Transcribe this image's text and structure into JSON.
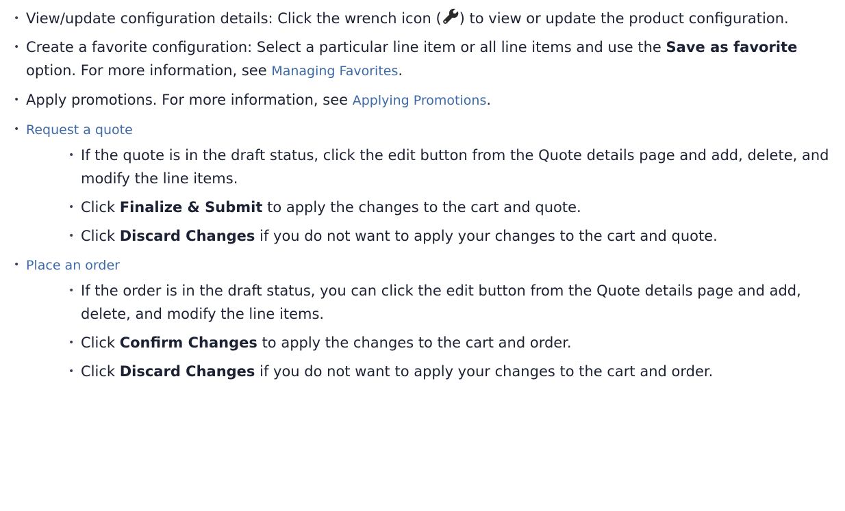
{
  "items": [
    {
      "text1": "View/update configuration details: Click the wrench icon (",
      "icon": "wrench-icon",
      "text2": ") to view or update the product configuration."
    },
    {
      "text1": "Create a favorite configuration: Select a particular line item or all line items and use the ",
      "bold": "Save as favorite",
      "text2": " option. For more information, see ",
      "link": "Managing Favorites",
      "text3": "."
    },
    {
      "text1": "Apply promotions. For more information, see ",
      "link": "Applying Promotions",
      "text2": "."
    },
    {
      "link": "Request a quote",
      "sub": [
        {
          "text1": "If the quote is in the draft status, click the edit button from the Quote details page and add, delete, and modify the line items."
        },
        {
          "text1": "Click ",
          "bold": "Finalize & Submit",
          "text2": " to apply the changes to the cart and quote."
        },
        {
          "text1": "Click ",
          "bold": "Discard Changes",
          "text2": " if you do not want to apply your changes to the cart and quote."
        }
      ]
    },
    {
      "link": "Place an order",
      "sub": [
        {
          "text1": "If the order is in the draft status, you can click the edit button from the Quote details page and add, delete, and modify the line items."
        },
        {
          "text1": "Click ",
          "bold": "Confirm Changes",
          "text2": " to apply the changes to the cart and order."
        },
        {
          "text1": "Click ",
          "bold": "Discard Changes",
          "text2": " if you do not want to apply your changes to the cart and order."
        }
      ]
    }
  ]
}
